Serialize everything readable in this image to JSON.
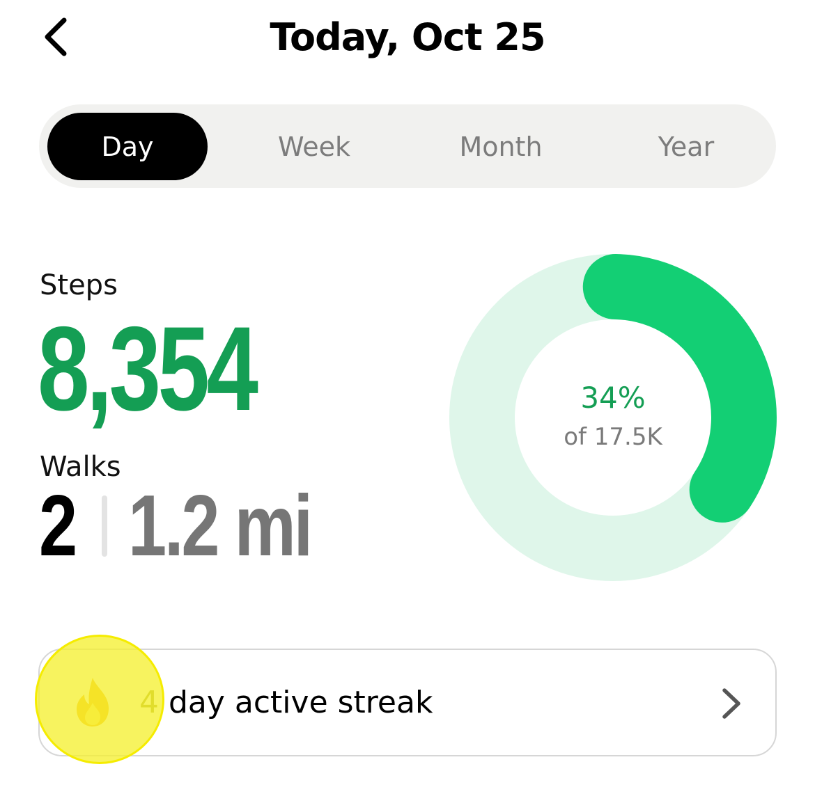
{
  "header": {
    "title": "Today, Oct 25"
  },
  "tabs": [
    {
      "label": "Day",
      "active": true
    },
    {
      "label": "Week",
      "active": false
    },
    {
      "label": "Month",
      "active": false
    },
    {
      "label": "Year",
      "active": false
    }
  ],
  "steps": {
    "label": "Steps",
    "value": "8,354"
  },
  "walks": {
    "label": "Walks",
    "count": "2",
    "distance": "1.2 mi"
  },
  "goal": {
    "percent_label": "34%",
    "of_label": "of 17.5K",
    "progress": 0.34
  },
  "streak": {
    "count": "4",
    "text": " day active streak",
    "icon": "flame-icon"
  },
  "colors": {
    "accent": "#149e54",
    "ring_fill": "#13cf74",
    "ring_track": "#dff6ea",
    "highlight": "#f5f032"
  }
}
